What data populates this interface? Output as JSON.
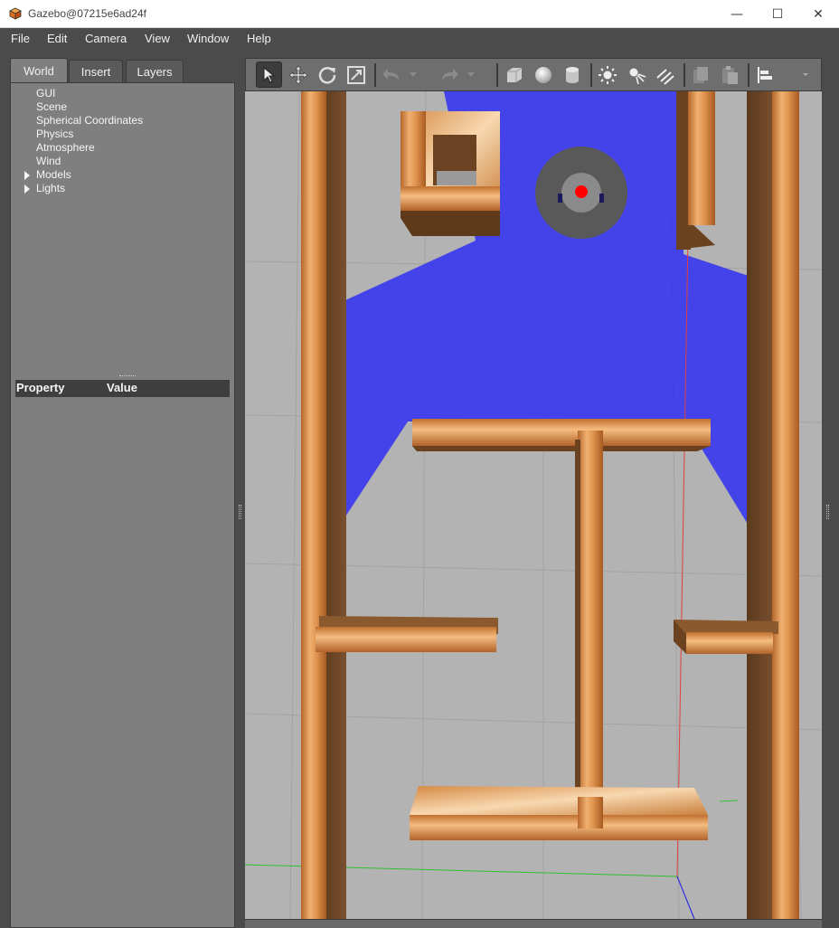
{
  "window": {
    "title": "Gazebo@07215e6ad24f",
    "minimize_glyph": "—",
    "maximize_glyph": "☐",
    "close_glyph": "✕"
  },
  "menu": {
    "file": "File",
    "edit": "Edit",
    "camera": "Camera",
    "view": "View",
    "window": "Window",
    "help": "Help"
  },
  "tabs": {
    "world": "World",
    "insert": "Insert",
    "layers": "Layers"
  },
  "world_tree": {
    "gui": "GUI",
    "scene": "Scene",
    "spherical": "Spherical Coordinates",
    "physics": "Physics",
    "atmosphere": "Atmosphere",
    "wind": "Wind",
    "models": "Models",
    "lights": "Lights"
  },
  "properties": {
    "col_property": "Property",
    "col_value": "Value"
  },
  "toolbar": {
    "icons": [
      "select-arrow-icon",
      "translate-icon",
      "rotate-icon",
      "scale-icon",
      "undo-icon",
      "redo-icon",
      "box-shape-icon",
      "sphere-shape-icon",
      "cylinder-shape-icon",
      "point-light-icon",
      "spot-light-icon",
      "directional-light-icon",
      "copy-icon",
      "paste-icon",
      "align-icon"
    ]
  },
  "colors": {
    "wall": "#d88a3c",
    "laser": "#2a2af0",
    "robot": "#555555",
    "marker": "#ff0000",
    "ground": "#b3b3b3"
  }
}
